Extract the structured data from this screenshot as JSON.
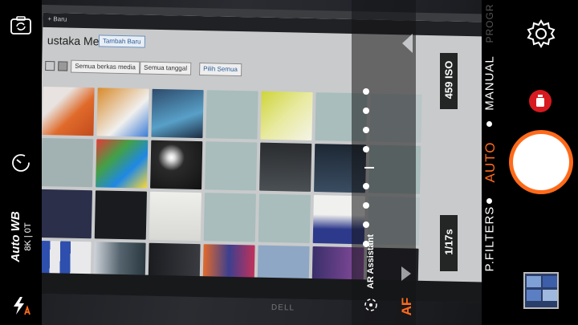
{
  "camera": {
    "white_balance": "Auto WB",
    "wb_values": "8K | 0T",
    "iso_readout": "459 ISO",
    "shutter_readout": "1/17s",
    "ar_assistant_label": "AR Assistant",
    "af_label": "AF",
    "modes": [
      "P.FILTERS",
      "AUTO",
      "MANUAL",
      "PROGR"
    ],
    "active_mode": "AUTO"
  },
  "screen_content": {
    "page_title": "ustaka Media",
    "add_new_button": "Tambah Baru",
    "top_bar_text": "+ Baru",
    "filter_media": "Semua berkas media",
    "filter_date": "Semua tanggal",
    "bulk_select": "Pilih Semua",
    "monitor_brand": "DELL"
  },
  "colors": {
    "accent": "#ff6a1a",
    "record": "#d71920"
  },
  "icons": [
    "rotate-camera-icon",
    "timer-icon",
    "flash-auto-icon",
    "gear-icon",
    "record-icon",
    "ar-target-icon"
  ]
}
